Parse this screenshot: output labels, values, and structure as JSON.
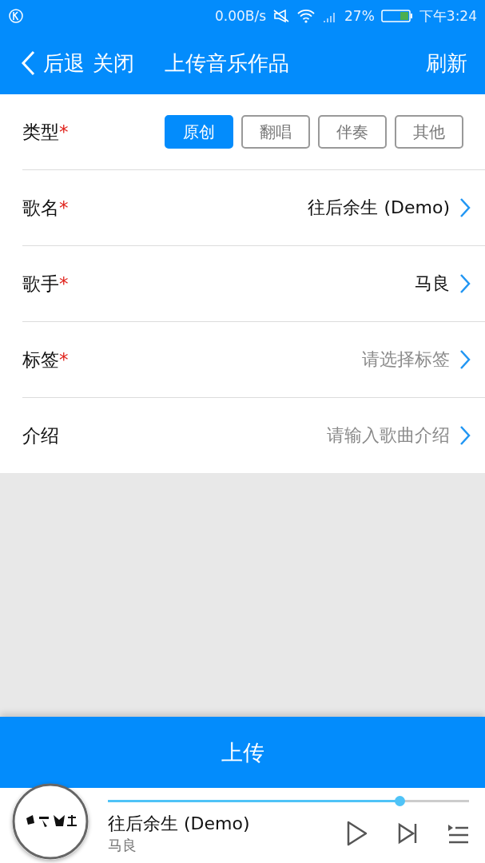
{
  "status_bar": {
    "net_speed": "0.00B/s",
    "battery": "27%",
    "time": "下午3:24"
  },
  "nav": {
    "back": "后退",
    "close": "关闭",
    "title": "上传音乐作品",
    "refresh": "刷新"
  },
  "type_row": {
    "label": "类型",
    "required_mark": "*",
    "options": [
      {
        "label": "原创",
        "selected": true
      },
      {
        "label": "翻唱",
        "selected": false
      },
      {
        "label": "伴奏",
        "selected": false
      },
      {
        "label": "其他",
        "selected": false
      }
    ]
  },
  "rows": [
    {
      "label": "歌名",
      "required_mark": "*",
      "value": "往后余生 (Demo)"
    },
    {
      "label": "歌手",
      "required_mark": "*",
      "value": "马良"
    },
    {
      "label": "标签",
      "required_mark": "*",
      "placeholder": "请选择标签"
    },
    {
      "label": "介绍",
      "placeholder": "请输入歌曲介绍"
    }
  ],
  "upload_button": "上传",
  "player": {
    "level": 0.807,
    "title": "往后余生 (Demo)",
    "artist": "马良"
  }
}
